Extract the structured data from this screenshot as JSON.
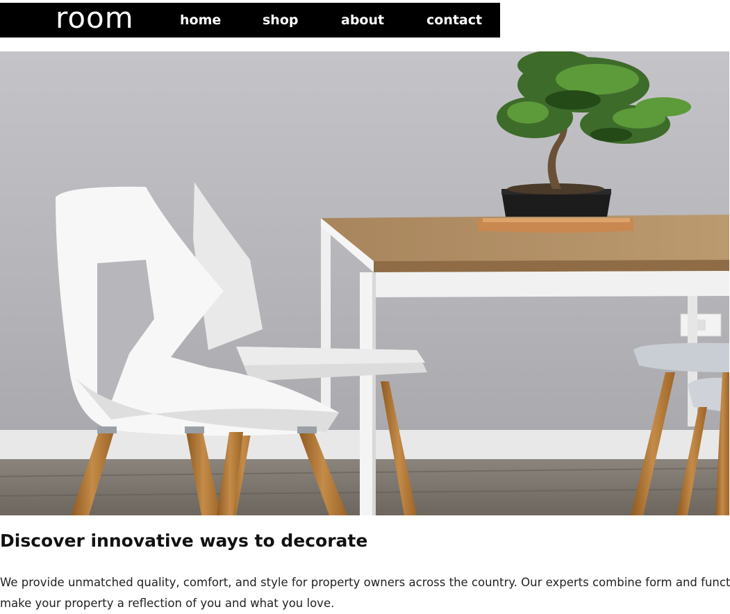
{
  "brand": {
    "logo_text": "room"
  },
  "nav": {
    "items": [
      {
        "label": "home"
      },
      {
        "label": "shop"
      },
      {
        "label": "about"
      },
      {
        "label": "contact"
      }
    ]
  },
  "hero": {
    "image_subject": "white chairs with wooden legs beside a wooden table with a bonsai tree"
  },
  "content": {
    "headline": "Discover innovative ways to decorate",
    "description_line1": "We provide unmatched quality, comfort, and style for property owners across the country. Our experts combine form and functio",
    "description_line2": "make your property a reflection of you and what you love."
  },
  "colors": {
    "nav_bg": "#000000",
    "nav_text": "#ffffff",
    "wall": "#b7b7bb",
    "tabletop": "#b08d62",
    "chair": "#f2f2f2",
    "wood_leg": "#b8803f"
  }
}
